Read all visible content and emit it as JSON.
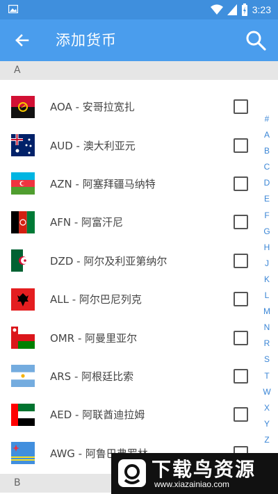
{
  "status_bar": {
    "time": "3:23"
  },
  "app_bar": {
    "title": "添加货币"
  },
  "sections": {
    "a": "A",
    "b": "B"
  },
  "currencies": [
    {
      "label": "AOA - 安哥拉宽扎",
      "flag": "angola-flag",
      "checked": false
    },
    {
      "label": "AUD - 澳大利亚元",
      "flag": "australia-flag",
      "checked": false
    },
    {
      "label": "AZN - 阿塞拜疆马纳特",
      "flag": "azerbaijan-flag",
      "checked": false
    },
    {
      "label": "AFN - 阿富汗尼",
      "flag": "afghanistan-flag",
      "checked": false
    },
    {
      "label": "DZD - 阿尔及利亚第纳尔",
      "flag": "algeria-flag",
      "checked": false
    },
    {
      "label": "ALL - 阿尔巴尼列克",
      "flag": "albania-flag",
      "checked": false
    },
    {
      "label": "OMR - 阿曼里亚尔",
      "flag": "oman-flag",
      "checked": false
    },
    {
      "label": "ARS - 阿根廷比索",
      "flag": "argentina-flag",
      "checked": false
    },
    {
      "label": "AED - 阿联酋迪拉姆",
      "flag": "uae-flag",
      "checked": false
    },
    {
      "label": "AWG - 阿鲁巴弗罗林",
      "flag": "aruba-flag",
      "checked": false
    }
  ],
  "index_letters": [
    "#",
    "A",
    "B",
    "C",
    "D",
    "E",
    "F",
    "G",
    "H",
    "J",
    "K",
    "L",
    "M",
    "N",
    "R",
    "S",
    "T",
    "W",
    "X",
    "Y",
    "Z"
  ],
  "watermark": {
    "title": "下载鸟资源",
    "url": "www.xiazainiao.com"
  },
  "colors": {
    "primary": "#4a9ded",
    "status_bar": "#3f8fdd",
    "index": "#3b86d6",
    "section_header": "#e6e6e6"
  }
}
